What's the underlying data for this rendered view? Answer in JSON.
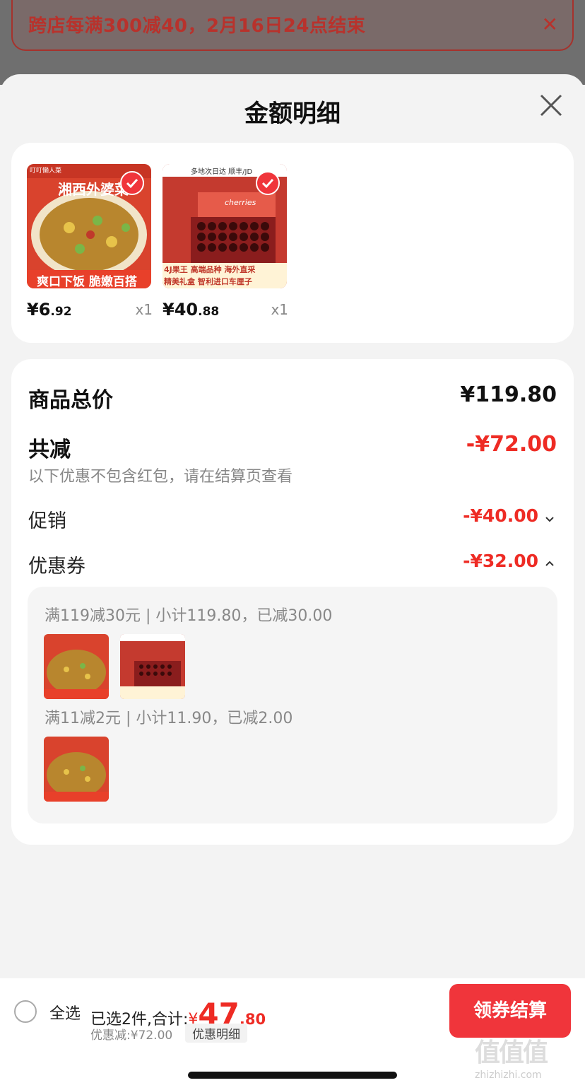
{
  "promo_banner": {
    "text": "跨店每满300减40，2月16日24点结束",
    "close_icon": "close-icon"
  },
  "sheet": {
    "title": "金额明细",
    "close_icon": "close-icon"
  },
  "items": [
    {
      "image_title": "湘西外婆菜",
      "image_caption": "爽口下饭 脆嫩百搭",
      "brand_tag": "叮叮懒人菜",
      "price_int": "¥6",
      "price_dec": ".92",
      "qty": "x1",
      "selected": true
    },
    {
      "image_title": "cherries",
      "image_caption_1": "4J果王 高端品种 海外直采",
      "image_caption_2": "精美礼盒 智利进口车厘子",
      "tags": "多地次日达  顺丰/JD",
      "price_int": "¥40",
      "price_dec": ".88",
      "qty": "x1",
      "selected": true
    }
  ],
  "summary": {
    "total_label": "商品总价",
    "total_value": "¥119.80",
    "reduce_label": "共减",
    "reduce_value": "-¥72.00",
    "note": "以下优惠不包含红包，请在结算页查看",
    "promo_label": "促销",
    "promo_value": "-¥40.00",
    "coupon_label": "优惠券",
    "coupon_value": "-¥32.00"
  },
  "coupon_details": [
    {
      "text": "满119减30元 | 小计119.80，已减30.00",
      "items": [
        "湘西外婆菜",
        "cherries"
      ]
    },
    {
      "text": "满11减2元 | 小计11.90，已减2.00",
      "items": [
        "湘西外婆菜"
      ]
    }
  ],
  "bottom_bar": {
    "select_all": "全选",
    "selected_info": "已选2件,合计:",
    "currency": "¥",
    "total_int": "47",
    "total_dec": ".80",
    "discount_line": "优惠减:¥72.00",
    "detail_chip": "优惠明细",
    "checkout_label": "领券结算"
  },
  "watermark": {
    "text": "值值值",
    "sub": "zhizhizhi.com"
  },
  "colors": {
    "accent": "#f0353b",
    "discount_red": "#ee2b24",
    "banner_text": "#b8322c"
  }
}
